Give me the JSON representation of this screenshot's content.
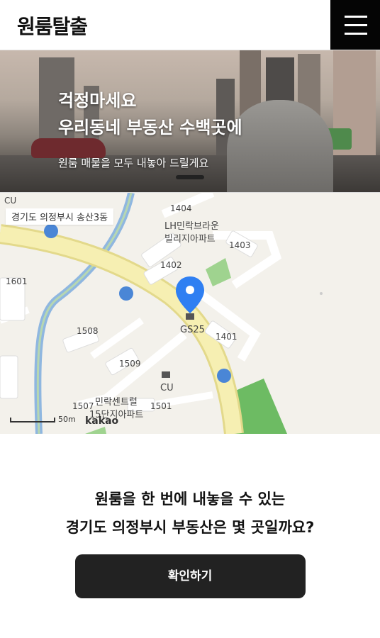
{
  "header": {
    "logo": "원룸탈출",
    "menu_icon": "hamburger-menu-icon"
  },
  "hero": {
    "title_line1": "걱정마세요",
    "title_line2": "우리동네 부동산 수백곳에",
    "subtitle": "원룸 매물을 모두 내놓아 드릴게요"
  },
  "map": {
    "location_tag": "경기도 의정부시 송산3동",
    "labels": {
      "cu_top": "CU",
      "b1404": "1404",
      "lh_line1": "LH민락브라운",
      "lh_line2": "빌리지아파트",
      "b1403": "1403",
      "b1402": "1402",
      "b1601": "1601",
      "gs25": "GS25",
      "b1401": "1401",
      "b1508": "1508",
      "b1509": "1509",
      "cu_bottom": "CU",
      "center_line1": "민락센트럴",
      "center_line2": "15단지아파트",
      "b1507": "1507",
      "b1501": "1501"
    },
    "scale": "50m",
    "brand": "kakao"
  },
  "main": {
    "question_line1": "원룸을 한 번에 내놓을 수 있는",
    "question_line2": "경기도 의정부시 부동산은 몇 곳일까요?",
    "cta_label": "확인하기"
  },
  "colors": {
    "cta": "#222222",
    "pin": "#2f7ff2",
    "menu_bg": "#050505",
    "road_yellow": "#f6efb2",
    "stream": "#8fb7e0",
    "park": "#6dbb63"
  }
}
